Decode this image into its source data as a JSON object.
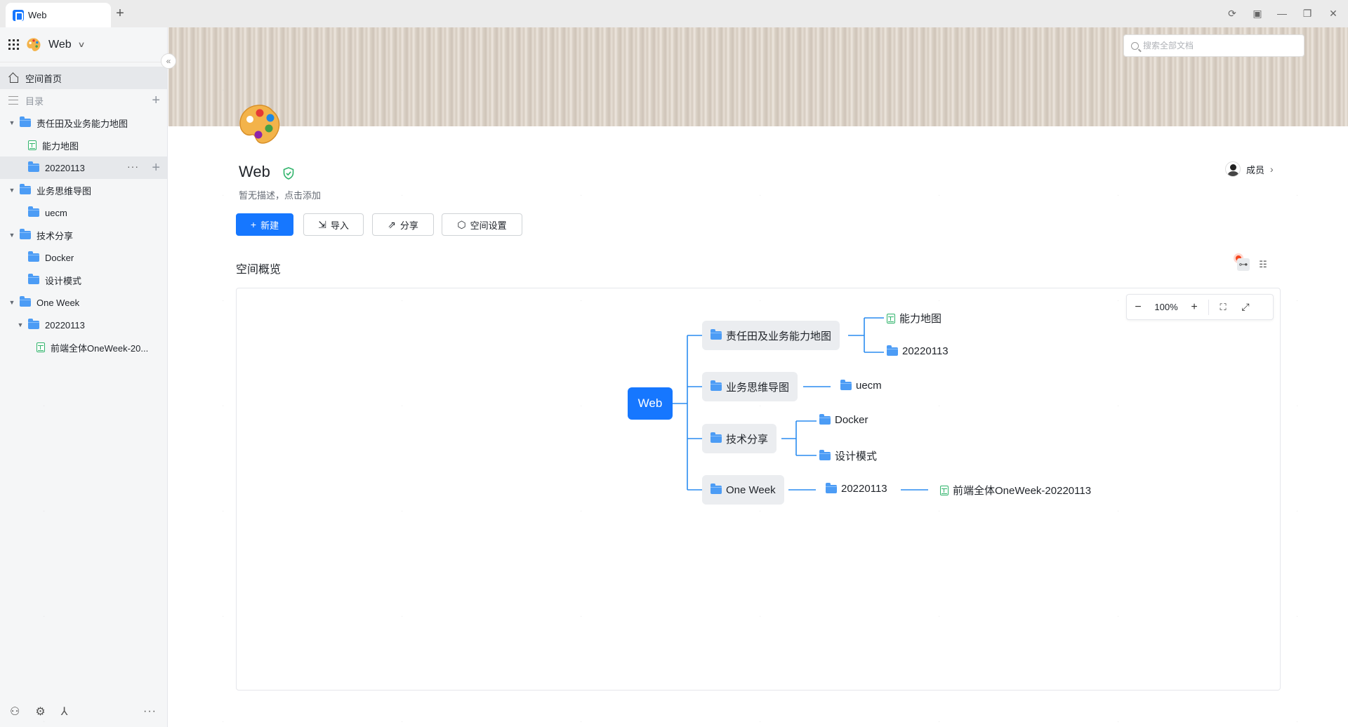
{
  "tabbar": {
    "tab_title": "Web",
    "new_tab_label": "+"
  },
  "sidebar": {
    "space_name": "Web",
    "home_label": "空间首页",
    "catalog_label": "目录",
    "tree": [
      {
        "label": "责任田及业务能力地图",
        "type": "folder",
        "level": 0,
        "expanded": true
      },
      {
        "label": "能力地图",
        "type": "sheet",
        "level": 1
      },
      {
        "label": "20220113",
        "type": "folder",
        "level": 1,
        "active": true
      },
      {
        "label": "业务思维导图",
        "type": "folder",
        "level": 0,
        "expanded": true
      },
      {
        "label": "uecm",
        "type": "folder",
        "level": 1
      },
      {
        "label": "技术分享",
        "type": "folder",
        "level": 0,
        "expanded": true
      },
      {
        "label": "Docker",
        "type": "folder",
        "level": 1
      },
      {
        "label": "设计模式",
        "type": "folder",
        "level": 1
      },
      {
        "label": "One Week",
        "type": "folder",
        "level": 0,
        "expanded": true
      },
      {
        "label": "20220113",
        "type": "folder",
        "level": 1,
        "expanded": true
      },
      {
        "label": "前端全体OneWeek-20...",
        "type": "sheet",
        "level": 2
      }
    ]
  },
  "header": {
    "search_placeholder": "搜索全部文档",
    "space_title": "Web",
    "space_desc": "暂无描述，点击添加",
    "members_label": "成员"
  },
  "actions": {
    "new_label": "新建",
    "import_label": "导入",
    "share_label": "分享",
    "settings_label": "空间设置"
  },
  "overview": {
    "title": "空间概览",
    "zoom": "100%"
  },
  "mindmap": {
    "root": "Web",
    "branches": [
      {
        "label": "责任田及业务能力地图",
        "children": [
          {
            "label": "能力地图",
            "type": "sheet"
          },
          {
            "label": "20220113",
            "type": "folder"
          }
        ]
      },
      {
        "label": "业务思维导图",
        "children": [
          {
            "label": "uecm",
            "type": "folder"
          }
        ]
      },
      {
        "label": "技术分享",
        "children": [
          {
            "label": "Docker",
            "type": "folder"
          },
          {
            "label": "设计模式",
            "type": "folder"
          }
        ]
      },
      {
        "label": "One Week",
        "children": [
          {
            "label": "20220113",
            "type": "folder",
            "children": [
              {
                "label": "前端全体OneWeek-20220113",
                "type": "sheet"
              }
            ]
          }
        ]
      }
    ]
  },
  "colors": {
    "accent": "#1677ff",
    "connector": "#2a8cf0",
    "folder": "#4c9cf5",
    "sheet": "#2fb36a"
  }
}
